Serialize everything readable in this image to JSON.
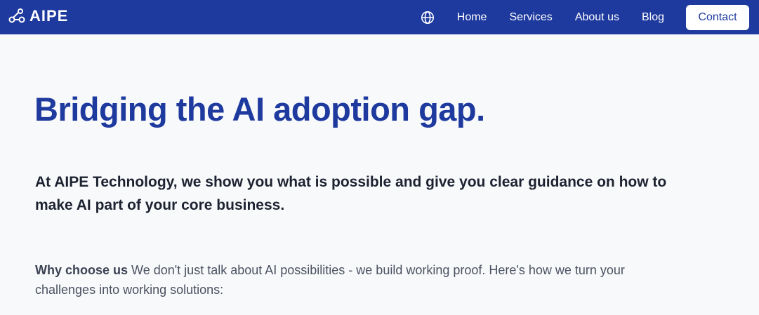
{
  "header": {
    "logo_text": "AIPE",
    "logo_icon": "nodes-icon",
    "language_icon": "globe-icon",
    "nav": [
      {
        "label": "Home"
      },
      {
        "label": "Services"
      },
      {
        "label": "About us"
      },
      {
        "label": "Blog"
      }
    ],
    "contact_label": "Contact",
    "bg_color": "#1e3a9e"
  },
  "hero": {
    "title": "Bridging the AI adoption gap.",
    "subtitle": "At AIPE Technology, we show you what is possible and give you clear guidance on how to make AI part of your core business.",
    "why_label": "Why choose us",
    "why_text": " We don't just talk about AI possibilities - we build working proof. Here's how we turn your challenges into working solutions:"
  }
}
